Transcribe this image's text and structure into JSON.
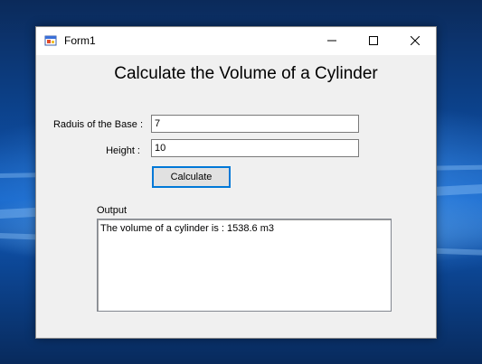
{
  "window": {
    "title": "Form1",
    "minimize_icon": "minimize-icon",
    "maximize_icon": "maximize-icon",
    "close_icon": "close-icon",
    "app_icon": "winforms-app-icon"
  },
  "form": {
    "heading": "Calculate the Volume of a Cylinder",
    "radius_label": "Raduis of the Base :",
    "radius_value": "7",
    "height_label": "Height :",
    "height_value": "10",
    "calculate_label": "Calculate",
    "output_label": "Output",
    "output_lines": [
      "The volume of a cylinder is : 1538.6 m3"
    ]
  },
  "colors": {
    "accent": "#0078d7",
    "window_bg": "#f0f0f0"
  }
}
